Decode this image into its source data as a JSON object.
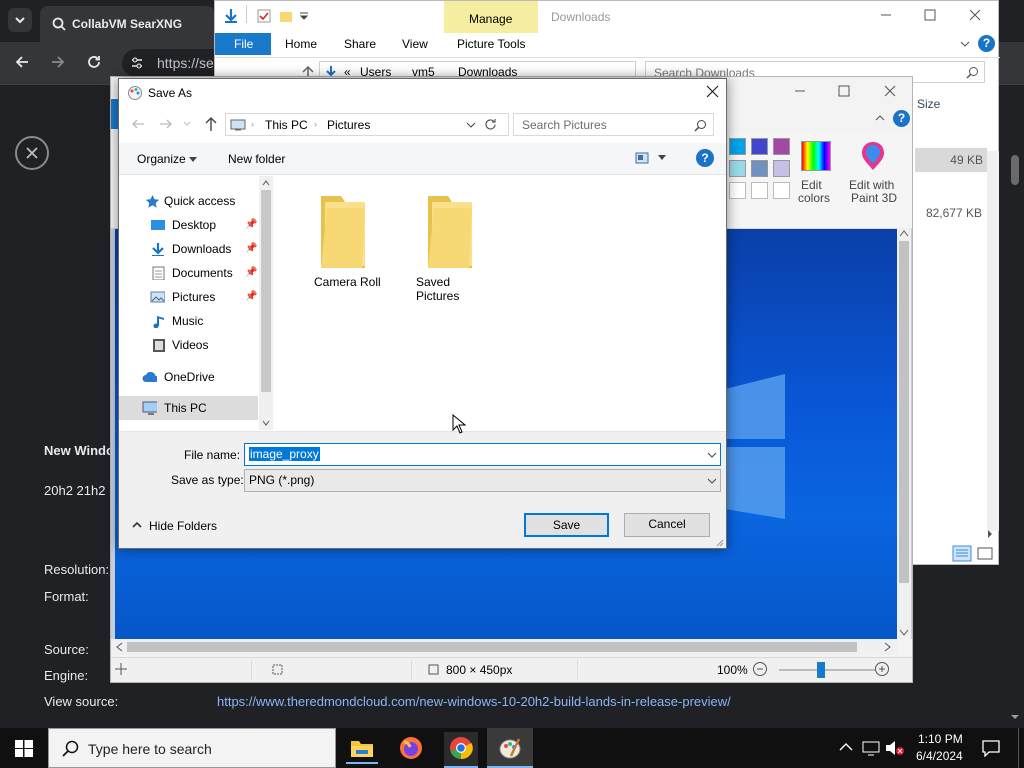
{
  "browser": {
    "tab_title": "CollabVM SearXNG",
    "url": "https://se",
    "details": {
      "title": "New Windo",
      "subtitle": "20h2 21h2",
      "resolution_label": "Resolution:",
      "format_label": "Format:",
      "source_label": "Source:",
      "engine_label": "Engine:",
      "view_source_label": "View source:",
      "view_source_url": "https://www.theredmondcloud.com/new-windows-10-20h2-build-lands-in-release-preview/"
    }
  },
  "explorer": {
    "title": "Downloads",
    "context_tab": "Manage",
    "ribbon_tabs": [
      "File",
      "Home",
      "Share",
      "View",
      "Picture Tools"
    ],
    "breadcrumb": [
      "«",
      "Users",
      "vm5",
      "Downloads"
    ],
    "search_placeholder": "Search Downloads",
    "column_size": "Size",
    "file_sizes": [
      "49 KB",
      "82,677 KB"
    ]
  },
  "paint": {
    "edit_colors": [
      "Edit",
      "colors"
    ],
    "edit_paint3d": [
      "Edit with",
      "Paint 3D"
    ],
    "status_dimensions": "800 × 450px",
    "zoom": "100%",
    "accent": "#0078d7"
  },
  "dialog": {
    "title": "Save As",
    "breadcrumb": [
      "This PC",
      "Pictures"
    ],
    "search_placeholder": "Search Pictures",
    "organize_label": "Organize",
    "new_folder_label": "New folder",
    "nav": {
      "quick_access": "Quick access",
      "desktop": "Desktop",
      "downloads": "Downloads",
      "documents": "Documents",
      "pictures": "Pictures",
      "music": "Music",
      "videos": "Videos",
      "onedrive": "OneDrive",
      "this_pc": "This PC"
    },
    "folders": [
      "Camera Roll",
      "Saved Pictures"
    ],
    "file_name_label": "File name:",
    "file_name_value": "image_proxy",
    "save_as_type_label": "Save as type:",
    "save_as_type_value": "PNG (*.png)",
    "hide_folders_label": "Hide Folders",
    "save_label": "Save",
    "cancel_label": "Cancel"
  },
  "taskbar": {
    "search_placeholder": "Type here to search",
    "time": "1:10 PM",
    "date": "6/4/2024"
  }
}
